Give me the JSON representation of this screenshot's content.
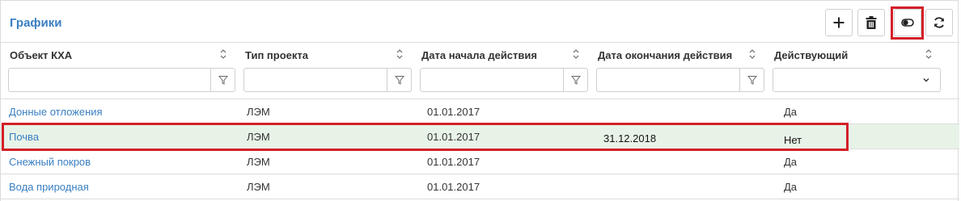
{
  "header": {
    "title": "Графики"
  },
  "toolbar": {
    "add_icon": "plus-icon",
    "delete_icon": "trash-icon",
    "toggle_icon": "toggle-icon",
    "refresh_icon": "refresh-icon"
  },
  "columns": [
    {
      "label": "Объект КХА",
      "filter_value": "",
      "filter_type": "text"
    },
    {
      "label": "Тип проекта",
      "filter_value": "",
      "filter_type": "text"
    },
    {
      "label": "Дата начала действия",
      "filter_value": "",
      "filter_type": "text"
    },
    {
      "label": "Дата окончания действия",
      "filter_value": "",
      "filter_type": "text"
    },
    {
      "label": "Действующий",
      "filter_value": "",
      "filter_type": "select"
    }
  ],
  "rows": [
    {
      "object": "Донные отложения",
      "project_type": "ЛЭМ",
      "start_date": "01.01.2017",
      "end_date": "",
      "active": "Да",
      "selected": false
    },
    {
      "object": "Почва",
      "project_type": "ЛЭМ",
      "start_date": "01.01.2017",
      "end_date": "31.12.2018",
      "active": "Нет",
      "selected": true
    },
    {
      "object": "Снежный покров",
      "project_type": "ЛЭМ",
      "start_date": "01.01.2017",
      "end_date": "",
      "active": "Да",
      "selected": false
    },
    {
      "object": "Вода природная",
      "project_type": "ЛЭМ",
      "start_date": "01.01.2017",
      "end_date": "",
      "active": "Да",
      "selected": false
    }
  ],
  "colors": {
    "accent": "#3a7fc1",
    "highlight": "#d32027",
    "selected_row": "#e8f3e8"
  }
}
